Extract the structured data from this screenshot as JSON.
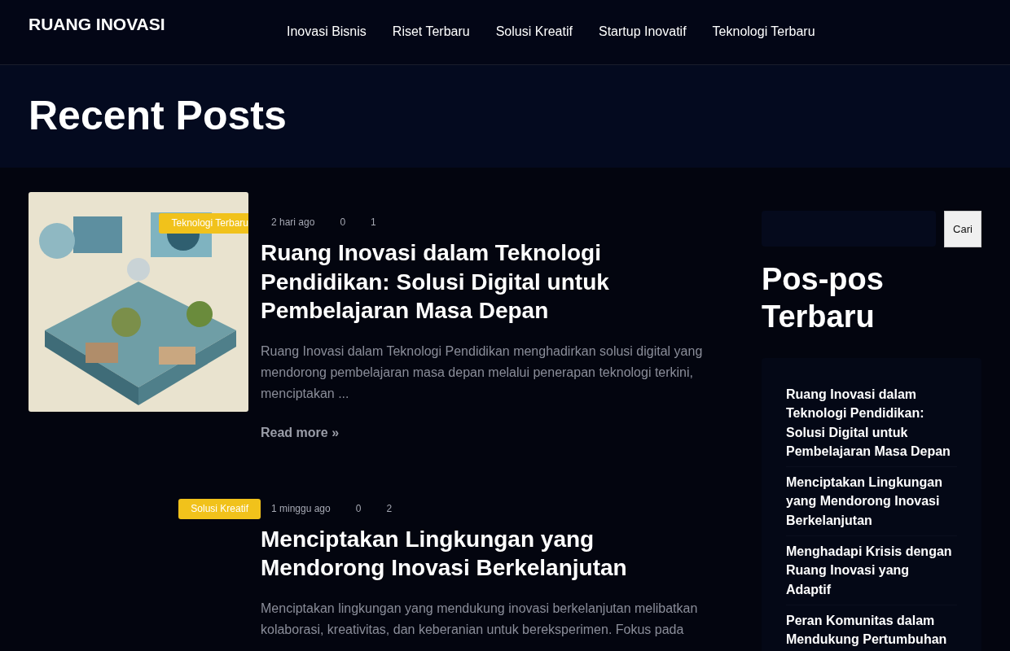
{
  "site_title": "RUANG INOVASI",
  "nav": [
    {
      "label": "Inovasi Bisnis"
    },
    {
      "label": "Riset Terbaru"
    },
    {
      "label": "Solusi Kreatif"
    },
    {
      "label": "Startup Inovatif"
    },
    {
      "label": "Teknologi Terbaru"
    }
  ],
  "page_title": "Recent Posts",
  "posts": [
    {
      "category": "Teknologi Terbaru",
      "date": "2 hari ago",
      "comments": "0",
      "views": "1",
      "title": "Ruang Inovasi dalam Teknologi Pendidikan: Solusi Digital untuk Pembelajaran Masa Depan",
      "excerpt": "Ruang Inovasi dalam Teknologi Pendidikan menghadirkan solusi digital yang mendorong pembelajaran masa depan melalui penerapan teknologi terkini, menciptakan ...",
      "read_more": "Read more »"
    },
    {
      "category": "Solusi Kreatif",
      "date": "1 minggu ago",
      "comments": "0",
      "views": "2",
      "title": "Menciptakan Lingkungan yang Mendorong Inovasi Berkelanjutan",
      "excerpt": "Menciptakan lingkungan yang mendukung inovasi berkelanjutan melibatkan kolaborasi, kreativitas, dan keberanian untuk bereksperimen. Fokus pada"
    }
  ],
  "sidebar": {
    "search_button": "Cari",
    "recent_title": "Pos-pos Terbaru",
    "recent_posts": [
      {
        "title": "Ruang Inovasi dalam Teknologi Pendidikan: Solusi Digital untuk Pembelajaran Masa Depan"
      },
      {
        "title": "Menciptakan Lingkungan yang Mendorong Inovasi Berkelanjutan"
      },
      {
        "title": "Menghadapi Krisis dengan Ruang Inovasi yang Adaptif"
      },
      {
        "title": "Peran Komunitas dalam Mendukung Pertumbuhan"
      }
    ]
  }
}
